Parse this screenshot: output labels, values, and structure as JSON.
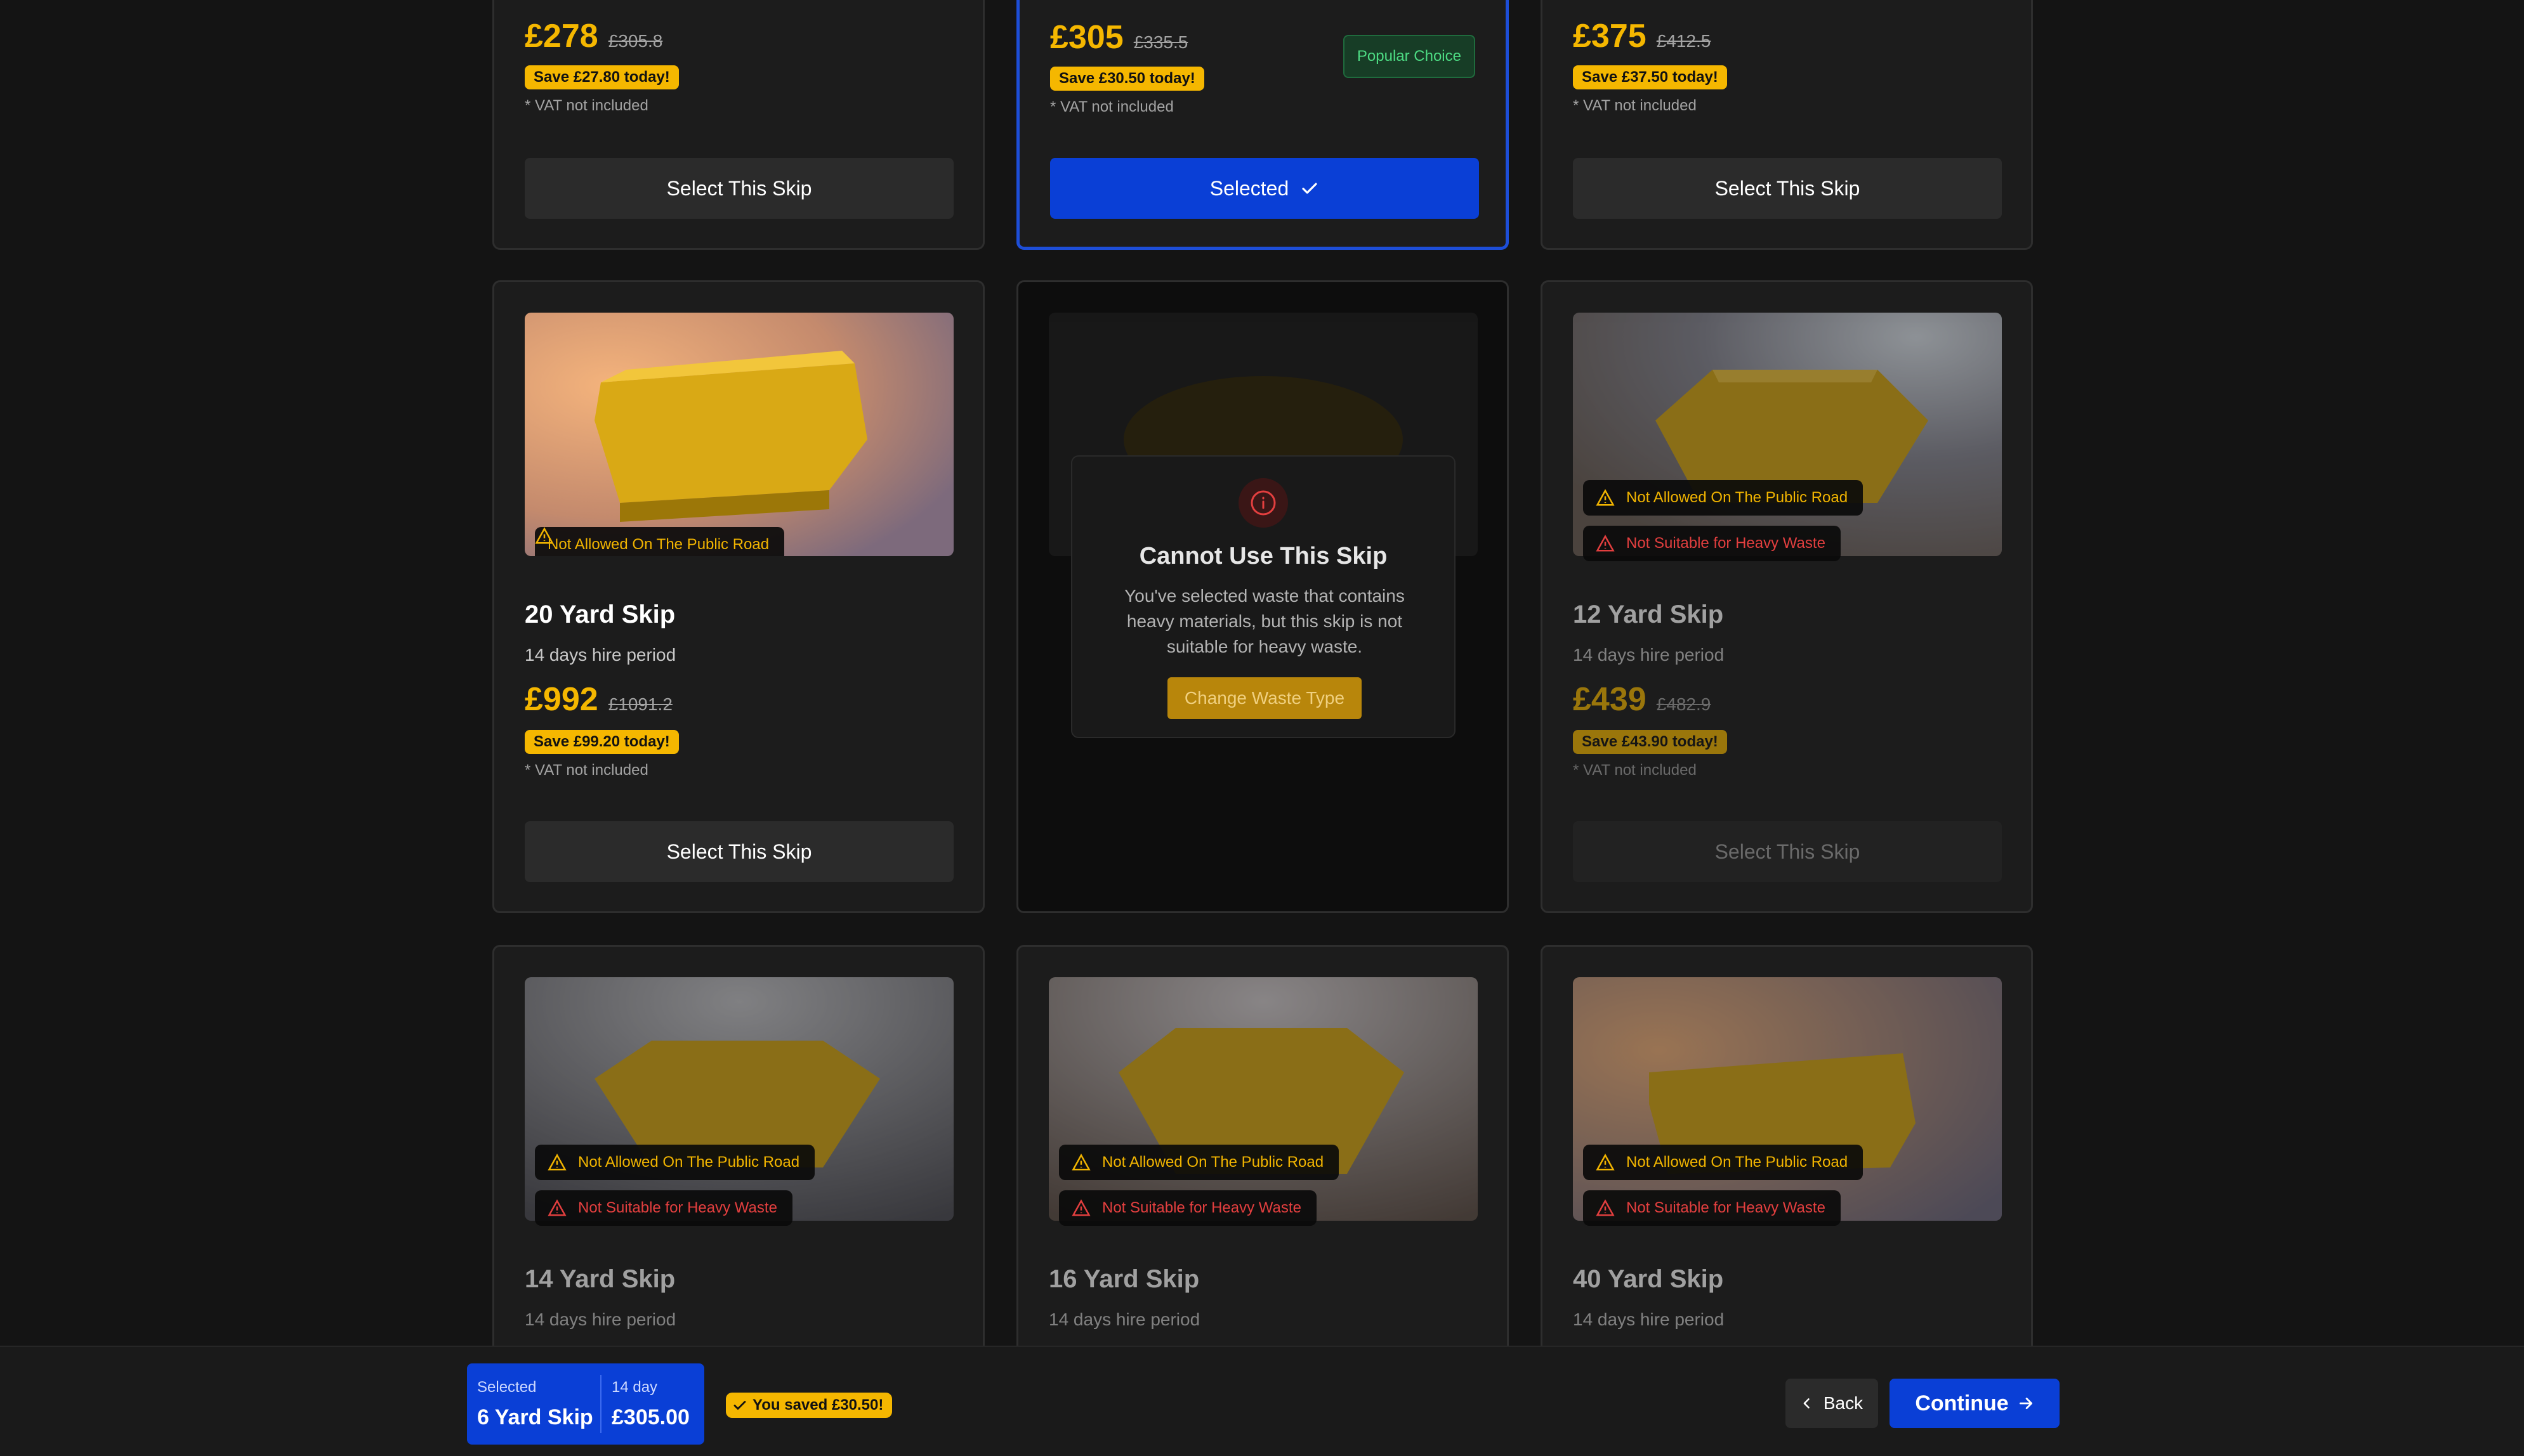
{
  "cards_top": [
    {
      "price": "£278",
      "was": "£305.8",
      "save": "Save £27.80 today!",
      "vat": "* VAT not included",
      "button": "Select This Skip"
    },
    {
      "price": "£305",
      "was": "£335.5",
      "save": "Save £30.50 today!",
      "vat": "* VAT not included",
      "button": "Selected",
      "badge": "Popular Choice"
    },
    {
      "price": "£375",
      "was": "£412.5",
      "save": "Save £37.50 today!",
      "vat": "* VAT not included",
      "button": "Select This Skip"
    }
  ],
  "cards_mid": [
    {
      "title": "20 Yard Skip",
      "hire": "14 days hire period",
      "price": "£992",
      "was": "£1091.2",
      "save": "Save £99.20 today!",
      "vat": "* VAT not included",
      "button": "Select This Skip",
      "warn1": "Not Allowed On The Public Road"
    },
    {
      "blocked": {
        "title": "Cannot Use This Skip",
        "message": "You've selected waste that contains heavy materials, but this skip is not suitable for heavy waste.",
        "button": "Change Waste Type"
      }
    },
    {
      "title": "12 Yard Skip",
      "hire": "14 days hire period",
      "price": "£439",
      "was": "£482.9",
      "save": "Save £43.90 today!",
      "vat": "* VAT not included",
      "button": "Select This Skip",
      "warn1": "Not Allowed On The Public Road",
      "warn2": "Not Suitable for Heavy Waste"
    }
  ],
  "cards_bottom": [
    {
      "title": "14 Yard Skip",
      "hire": "14 days hire period",
      "warn1": "Not Allowed On The Public Road",
      "warn2": "Not Suitable for Heavy Waste"
    },
    {
      "title": "16 Yard Skip",
      "hire": "14 days hire period",
      "warn1": "Not Allowed On The Public Road",
      "warn2": "Not Suitable for Heavy Waste"
    },
    {
      "title": "40 Yard Skip",
      "hire": "14 days hire period",
      "warn1": "Not Allowed On The Public Road",
      "warn2": "Not Suitable for Heavy Waste"
    }
  ],
  "footer": {
    "selected_label": "Selected",
    "selected_value": "6 Yard Skip",
    "period_label": "14 day",
    "period_value": "£305.00",
    "saved": "You saved £30.50!",
    "back": "Back",
    "continue": "Continue"
  },
  "colors": {
    "accent": "#0a3fd6",
    "price": "#f5b700",
    "warning": "#f1b400",
    "danger": "#e33f3f"
  },
  "icons": [
    "warning-triangle-icon",
    "checkmark-icon",
    "info-icon",
    "chevron-left-icon",
    "arrow-right-icon"
  ]
}
